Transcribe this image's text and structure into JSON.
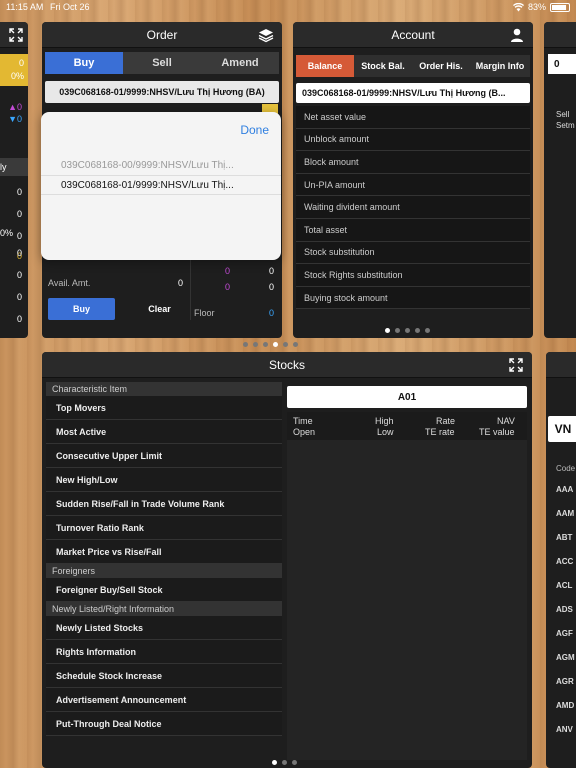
{
  "status": {
    "time": "11:15 AM",
    "date": "Fri Oct 26",
    "battery": "83%"
  },
  "left_panel": {
    "top_value": "0",
    "top_pct": "0%",
    "up_count": "0",
    "down_count": "0",
    "label_fragment": "ly",
    "values": [
      "0",
      "0",
      "0",
      "0",
      "0%",
      "0",
      "0",
      "0",
      "0"
    ]
  },
  "order": {
    "title": "Order",
    "tabs": [
      "Buy",
      "Sell",
      "Amend"
    ],
    "account_selected": "039C068168-01/9999:NHSV/Lưu Thị Hương (BA)",
    "picker": {
      "done": "Done",
      "options": [
        "039C068168-00/9999:NHSV/Lưu Thị...",
        "039C068168-01/9999:NHSV/Lưu Thị..."
      ]
    },
    "avail_label": "Avail. Amt.",
    "avail_value": "0",
    "buy_button": "Buy",
    "clear_button": "Clear",
    "floor_label": "Floor",
    "floor_value": "0",
    "side_values": [
      "0",
      "0",
      "0",
      "0",
      "0",
      "0"
    ]
  },
  "account": {
    "title": "Account",
    "tabs": [
      "Balance",
      "Stock Bal.",
      "Order His.",
      "Margin Info"
    ],
    "account_selected": "039C068168-01/9999:NHSV/Lưu Thị Hương (B...",
    "items": [
      "Net asset value",
      "Unblock amount",
      "Block amount",
      "Un-PIA amount",
      "Waiting divident amount",
      "Total asset",
      "Stock substitution",
      "Stock Rights substitution",
      "Buying stock amount"
    ]
  },
  "right_top": {
    "value": "0",
    "label1": "Sell",
    "label2": "Setm"
  },
  "stocks": {
    "title": "Stocks",
    "sections": [
      {
        "header": "Characteristic Item",
        "items": [
          "Top Movers",
          "Most Active",
          "Consecutive Upper Limit",
          "New High/Low",
          "Sudden Rise/Fall in Trade Volume Rank",
          "Turnover Ratio Rank",
          "Market Price vs Rise/Fall"
        ]
      },
      {
        "header": "Foreigners",
        "items": [
          "Foreigner Buy/Sell Stock"
        ]
      },
      {
        "header": "Newly Listed/Right Information",
        "items": [
          "Newly Listed Stocks",
          "Rights Information",
          "Schedule Stock Increase",
          "Advertisement Announcement",
          "Put-Through Deal Notice"
        ]
      }
    ],
    "code": "A01",
    "columns": {
      "time": "Time",
      "open": "Open",
      "high": "High",
      "low": "Low",
      "rate": "Rate",
      "te_rate": "TE rate",
      "nav": "NAV",
      "te_value": "TE value"
    }
  },
  "right_bottom": {
    "badge": "VN",
    "header": "Code",
    "codes": [
      "AAA",
      "AAM",
      "ABT",
      "ACC",
      "ACL",
      "ADS",
      "AGF",
      "AGM",
      "AGR",
      "AMD",
      "ANV"
    ]
  },
  "colors": {
    "buy_blue": "#3a6fd6",
    "balance_orange": "#d55a37",
    "done_blue": "#2f7fe0"
  }
}
